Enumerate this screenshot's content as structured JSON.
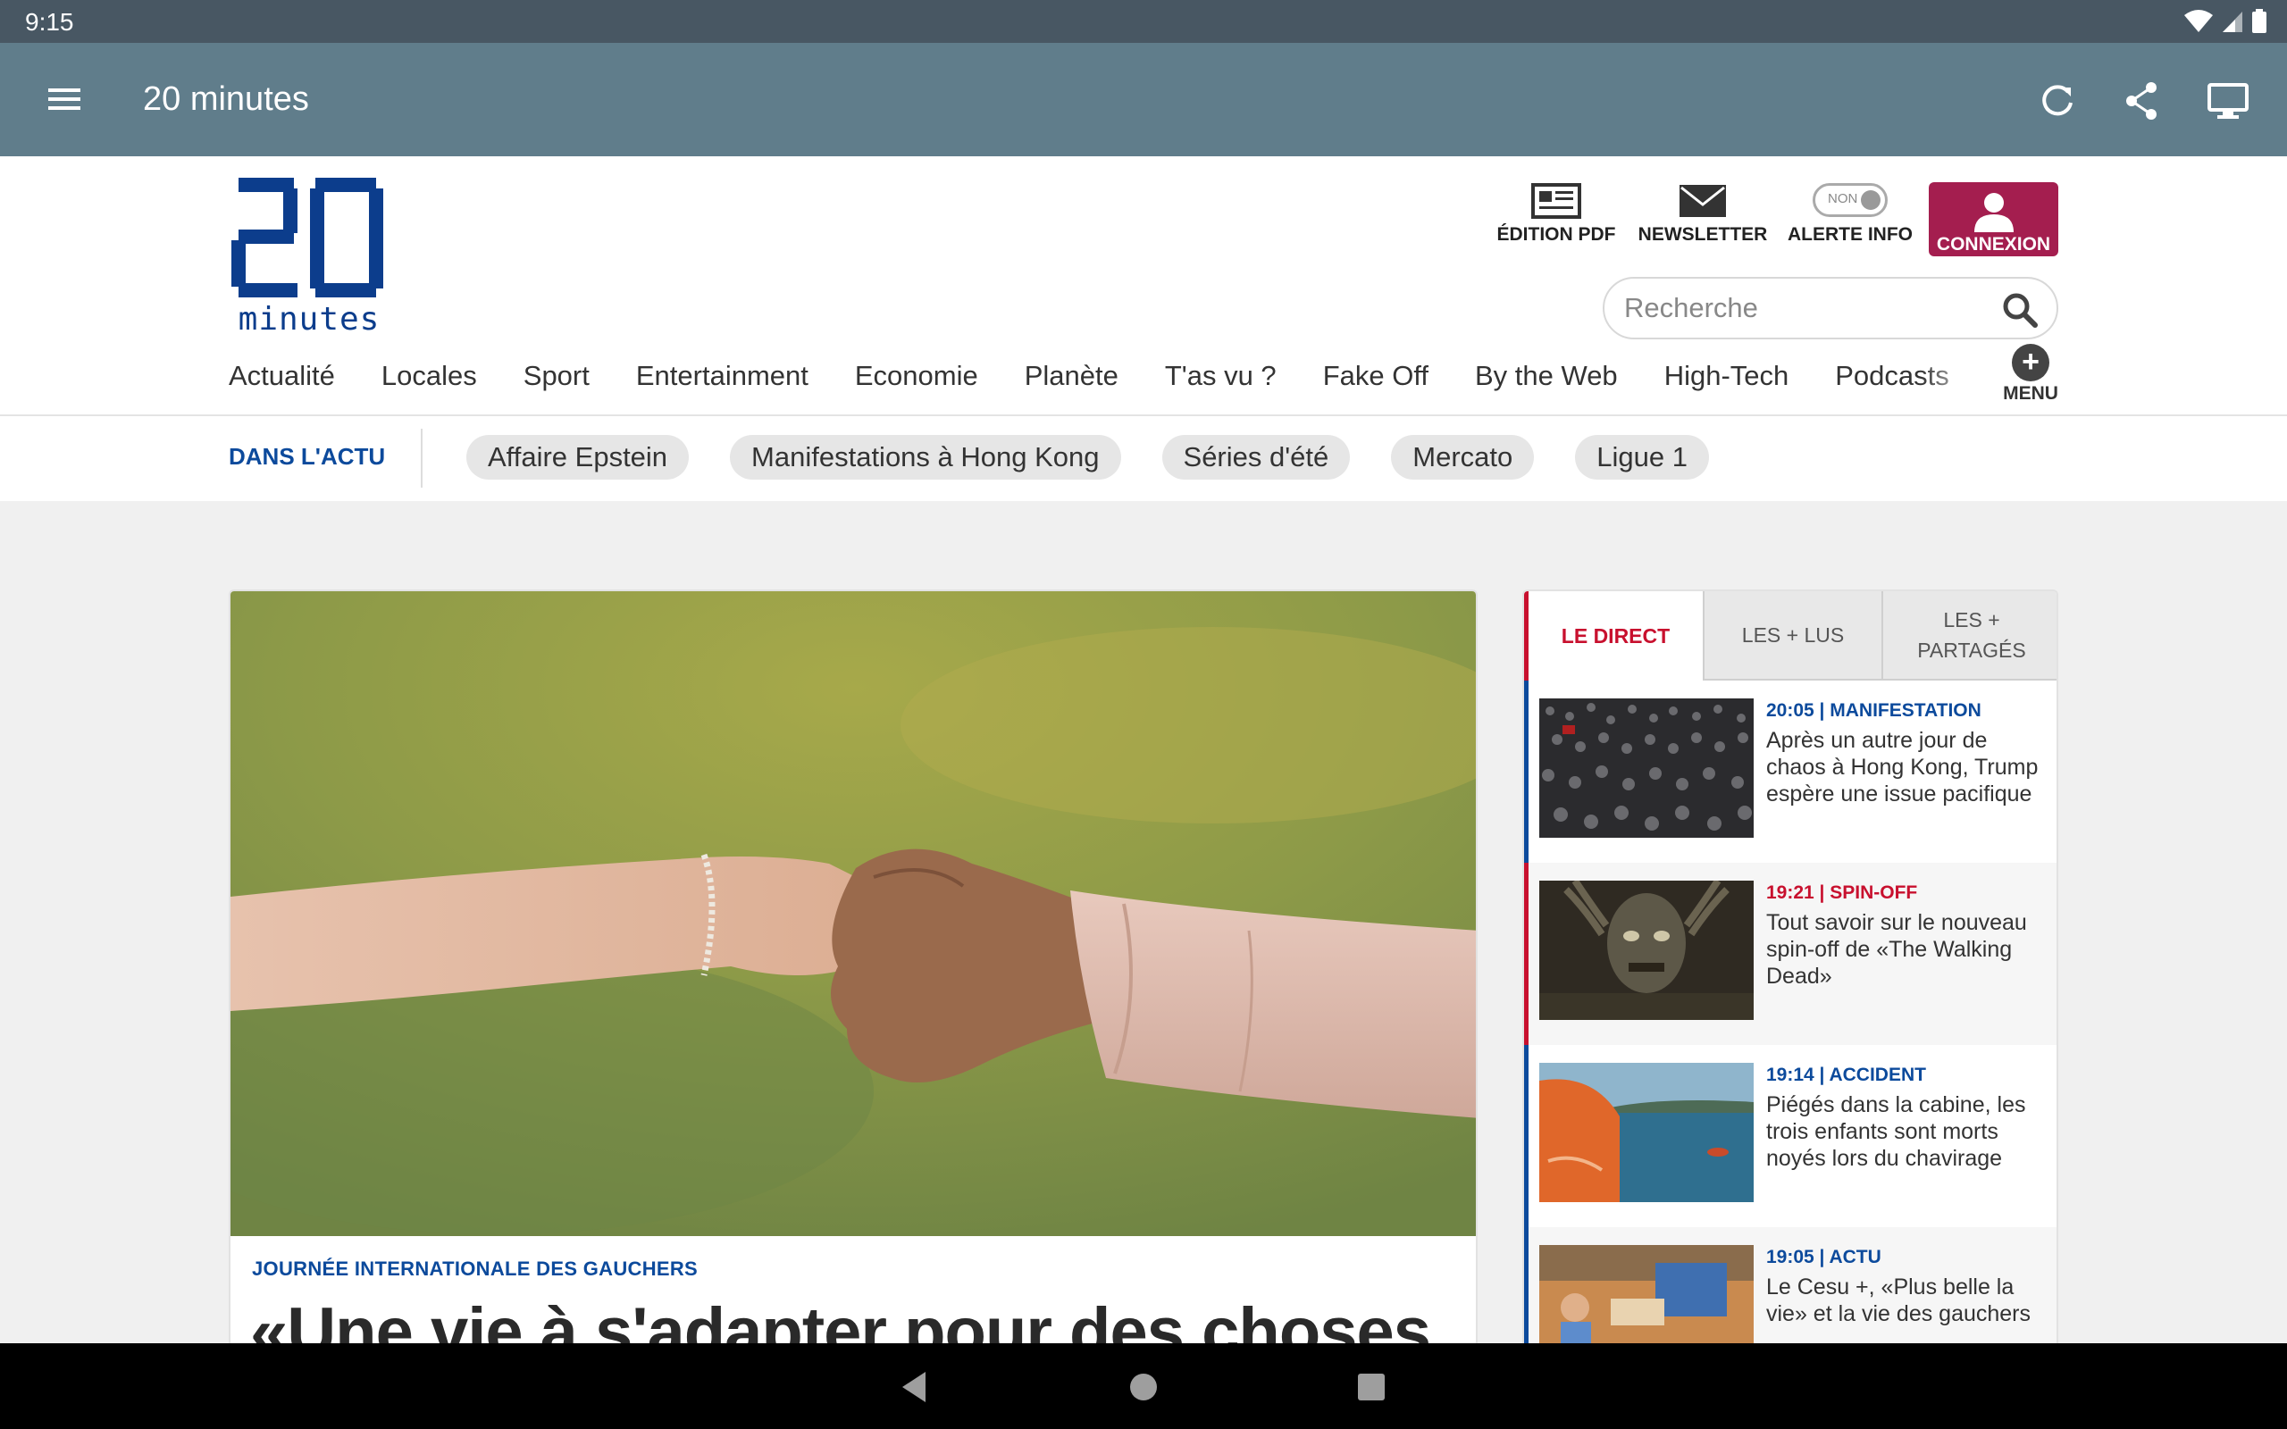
{
  "status_bar": {
    "time": "9:15"
  },
  "app_bar": {
    "title": "20 minutes"
  },
  "site": {
    "logo_digits": "20",
    "logo_word": "minutes",
    "tools": {
      "pdf": "ÉDITION PDF",
      "newsletter": "NEWSLETTER",
      "alerte": "ALERTE INFO",
      "alerte_toggle": "NON",
      "connexion": "CONNEXION"
    },
    "search_placeholder": "Recherche",
    "nav": [
      "Actualité",
      "Locales",
      "Sport",
      "Entertainment",
      "Economie",
      "Planète",
      "T'as vu ?",
      "Fake Off",
      "By the Web",
      "High-Tech",
      "Podcasts"
    ],
    "menu_label": "MENU",
    "menu_plus": "+"
  },
  "actu": {
    "label": "DANS L'ACTU",
    "chips": [
      "Affaire Epstein",
      "Manifestations à Hong Kong",
      "Séries d'été",
      "Mercato",
      "Ligue 1"
    ]
  },
  "main_article": {
    "kicker": "JOURNÉE INTERNATIONALE DES GAUCHERS",
    "headline": "«Une vie à s'adapter pour des choses"
  },
  "sidebar": {
    "tabs": [
      "LE DIRECT",
      "LES + LUS",
      "LES + PARTAGÉS"
    ],
    "feed": [
      {
        "time": "20:05",
        "category": "MANIFESTATION",
        "meta": "20:05 | MANIFESTATION",
        "title": "Après un autre jour de chaos à Hong Kong, Trump espère une issue pacifique"
      },
      {
        "time": "19:21",
        "category": "SPIN-OFF",
        "meta": "19:21 | SPIN-OFF",
        "title": "Tout savoir sur le nouveau spin-off de «The Walking Dead»"
      },
      {
        "time": "19:14",
        "category": "ACCIDENT",
        "meta": "19:14 | ACCIDENT",
        "title": "Piégés dans la cabine, les trois enfants sont morts noyés lors du chavirage"
      },
      {
        "time": "19:05",
        "category": "ACTU",
        "meta": "19:05 | ACTU",
        "title": "Le Cesu +, «Plus belle la vie» et la vie des gauchers"
      }
    ]
  },
  "colors": {
    "app_bar": "#607d8b",
    "status_bar": "#485763",
    "brand_blue": "#0c4a9c",
    "live_red": "#c8102e",
    "connexion": "#a41e4f"
  }
}
